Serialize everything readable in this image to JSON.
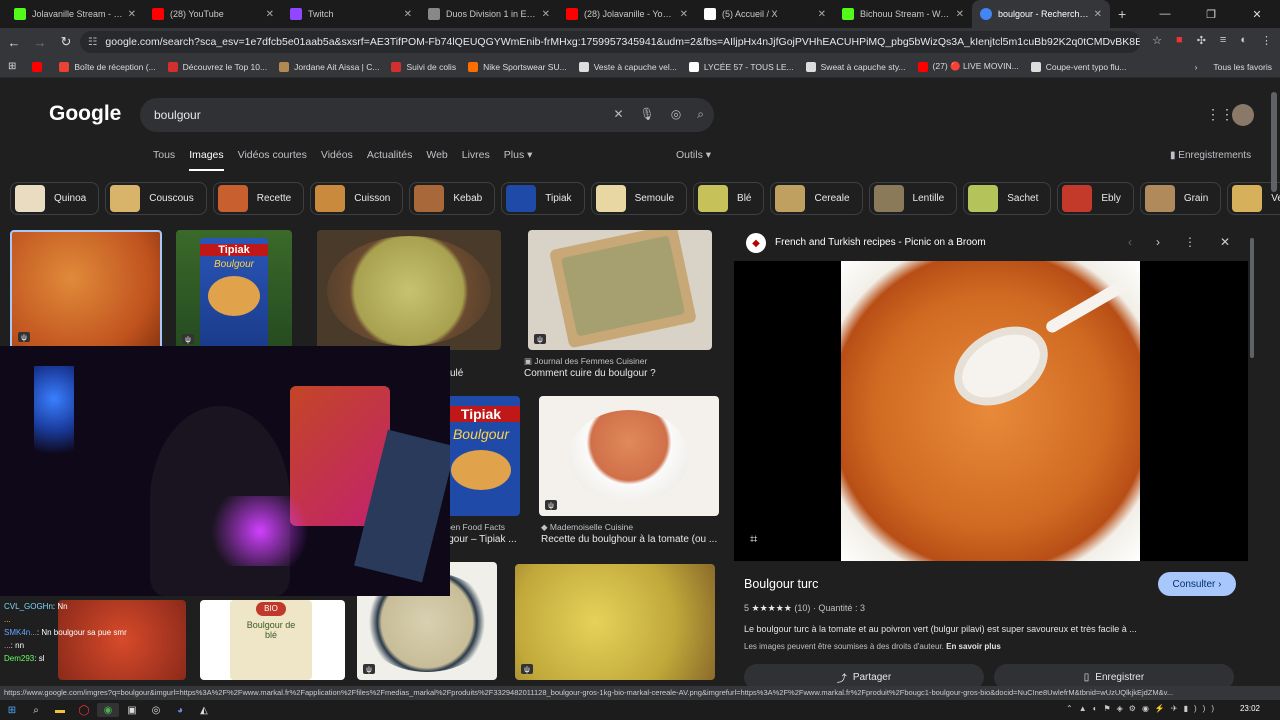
{
  "tabs": [
    {
      "title": "Jolavanille Stream - Watc",
      "color": "#53fc18"
    },
    {
      "title": "(28) YouTube",
      "color": "#ff0000"
    },
    {
      "title": "Twitch",
      "color": "#9146ff"
    },
    {
      "title": "Duos Division 1 in Europe",
      "color": "#888888"
    },
    {
      "title": "(28) Jolavanille - YouTube",
      "color": "#ff0000"
    },
    {
      "title": "(5) Accueil / X",
      "color": "#ffffff"
    },
    {
      "title": "Bichouu Stream - Watch",
      "color": "#53fc18"
    },
    {
      "title": "boulgour - Recherche Go",
      "color": "#4285f4"
    }
  ],
  "url": "google.com/search?sca_esv=1e7dfcb5e01aab5a&sxsrf=AE3TifPOM-Fb74lQEUQGYWmEnib-frMHxg:1759957345941&udm=2&fbs=AIljpHx4nJjfGojPVHhEACUHPiMQ_pbg5bWizQs3A_kIenjtcl5m1cuBb92K2q0tCMDvBK8EzCOmw7_nopkk8T-EnH0...",
  "bookmarks": [
    {
      "label": "",
      "color": "#ff0000"
    },
    {
      "label": "Boîte de réception (...",
      "color": "#ea4335"
    },
    {
      "label": "Découvrez le Top 10...",
      "color": "#d32f2f"
    },
    {
      "label": "Jordane Ait Aissa | C...",
      "color": "#b08a50"
    },
    {
      "label": "Suivi de colis",
      "color": "#d32f2f"
    },
    {
      "label": "Nike Sportswear SU...",
      "color": "#ff6d00"
    },
    {
      "label": "Veste à capuche vel...",
      "color": "#dddddd"
    },
    {
      "label": "LYCÉE 57 - TOUS LE...",
      "color": "#ffffff"
    },
    {
      "label": "Sweat à capuche sty...",
      "color": "#dddddd"
    },
    {
      "label": "(27) 🔴 LIVE MOVIN...",
      "color": "#ff0000"
    },
    {
      "label": "Coupe-vent typo flu...",
      "color": "#dddddd"
    }
  ],
  "bookmarks_right": [
    "›",
    "Tous les favoris"
  ],
  "google": {
    "logo": "Google",
    "query": "boulgour",
    "tabs": [
      "Tous",
      "Images",
      "Vidéos courtes",
      "Vidéos",
      "Actualités",
      "Web",
      "Livres",
      "Plus ▾"
    ],
    "active_tab": "Images",
    "outils": "Outils ▾",
    "saved": "Enregistrements"
  },
  "chips": [
    {
      "label": "Quinoa",
      "color": "#e9dcc0"
    },
    {
      "label": "Couscous",
      "color": "#d8b46a"
    },
    {
      "label": "Recette",
      "color": "#c85f2e"
    },
    {
      "label": "Cuisson",
      "color": "#c98a3d"
    },
    {
      "label": "Kebab",
      "color": "#a8683a"
    },
    {
      "label": "Tipiak",
      "color": "#1f4aa8"
    },
    {
      "label": "Semoule",
      "color": "#e9d7a3"
    },
    {
      "label": "Blé",
      "color": "#c7c15a"
    },
    {
      "label": "Cereale",
      "color": "#c0a060"
    },
    {
      "label": "Lentille",
      "color": "#8a7a5a"
    },
    {
      "label": "Sachet",
      "color": "#b4c45a"
    },
    {
      "label": "Ebly",
      "color": "#c43a2a"
    },
    {
      "label": "Grain",
      "color": "#b08a5a"
    },
    {
      "label": "Vermicelle",
      "color": "#d6b05a"
    }
  ],
  "results": {
    "r1": {
      "source": "",
      "caption": "ulé"
    },
    "r2": {
      "source": "Journal des Femmes Cuisiner",
      "caption": "Comment cuire du boulgour ?"
    },
    "r3": {
      "source": "pen Food Facts",
      "caption": "lgour – Tipiak ..."
    },
    "r4": {
      "source": "Mademoiselle Cuisine",
      "caption": "Recette du boulghour à la tomate (ou ..."
    },
    "tipiak_label": "Tipiak",
    "tipiak_sub": "Boulgour",
    "bio_label": "BIO",
    "bio_sub": "Boulgour de blé"
  },
  "panel": {
    "source": "French and Turkish recipes - Picnic on a Broom",
    "title": "Boulgour turc",
    "visit": "Consulter ›",
    "rating": "5",
    "stars": "★★★★★",
    "reviews": "(10)",
    "quantity": "· Quantité : 3",
    "description": "Le boulgour turc à la tomate et au poivron vert (bulgur pilavi) est super savoureux et très facile à ...",
    "copyright": "Les images peuvent être soumises à des droits d'auteur.",
    "learn_more": "En savoir plus",
    "share": "Partager",
    "save": "Enregistrer"
  },
  "chat": [
    {
      "user": "CVL_GOGHn",
      "msg": ": Nn",
      "color": "#7fd4ff"
    },
    {
      "user": "...",
      "msg": "",
      "color": "#ffcc00"
    },
    {
      "user": "SMK4n...",
      "msg": ": Nn boulgour sa pue smr",
      "color": "#66a3ff"
    },
    {
      "user": "...",
      "msg": ": nn",
      "color": "#ff88cc"
    },
    {
      "user": "Dem293",
      "msg": ": sl",
      "color": "#66ff66"
    }
  ],
  "status_url": "https://www.google.com/imgres?q=boulgour&imgurl=https%3A%2F%2Fwww.markal.fr%2Fapplication%2Ffiles%2Fmedias_markal%2Fproduits%2F3329482011128_boulgour-gros-1kg-bio-markal-cereale-AV.png&imgrefurl=https%3A%2F%2Fwww.markal.fr%2Fproduit%2Fbougc1-boulgour-gros-bio&docid=NuCIne8UwlefrM&tbnid=wUzUQlkjkEjdZM&v...",
  "clock": "23:02"
}
